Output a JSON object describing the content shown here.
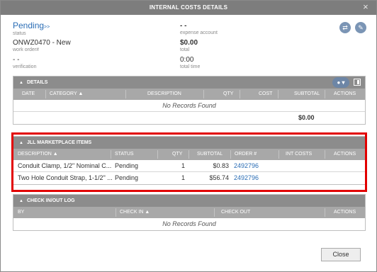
{
  "window": {
    "title": "INTERNAL COSTS DETAILS",
    "close_glyph": "×"
  },
  "header": {
    "status": {
      "value": "Pending",
      "suffix": ">>",
      "label": "status"
    },
    "work_order": {
      "value": "ONWZ0470 - New",
      "label": "work order#"
    },
    "verification": {
      "value": "- -",
      "label": "verification"
    },
    "expense_account": {
      "value": "- -",
      "label": "expense account"
    },
    "total": {
      "value": "$0.00",
      "label": "total"
    },
    "total_time": {
      "value": "0:00",
      "label": "total time"
    },
    "buttons": [
      {
        "icon": "swap-icon"
      },
      {
        "icon": "pencil-icon"
      }
    ]
  },
  "details": {
    "title": "DETAILS",
    "columns": [
      "DATE",
      "CATEGORY ▲",
      "DESCRIPTION",
      "QTY",
      "COST",
      "SUBTOTAL",
      "ACTIONS"
    ],
    "empty_text": "No Records Found",
    "total": "$0.00"
  },
  "jll": {
    "title": "JLL MARKETPLACE ITEMS",
    "columns": [
      "DESCRIPTION ▲",
      "STATUS",
      "QTY",
      "SUBTOTAL",
      "ORDER #",
      "INT COSTS",
      "ACTIONS"
    ],
    "rows": [
      {
        "description": "Conduit Clamp, 1/2\" Nominal C...",
        "status": "Pending",
        "qty": "1",
        "subtotal": "$0.83",
        "order": "2492796"
      },
      {
        "description": "Two Hole Conduit Strap, 1-1/2\" ...",
        "status": "Pending",
        "qty": "1",
        "subtotal": "$56.74",
        "order": "2492796"
      }
    ]
  },
  "checklog": {
    "title": "CHECK IN/OUT LOG",
    "columns": [
      "BY",
      "CHECK IN ▲",
      "CHECK OUT",
      "ACTIONS"
    ],
    "empty_text": "No Records Found"
  },
  "footer": {
    "close_label": "Close"
  },
  "colors": {
    "highlight": "#e20000",
    "link": "#2a6db5",
    "header_bar": "#7d7d7d"
  }
}
